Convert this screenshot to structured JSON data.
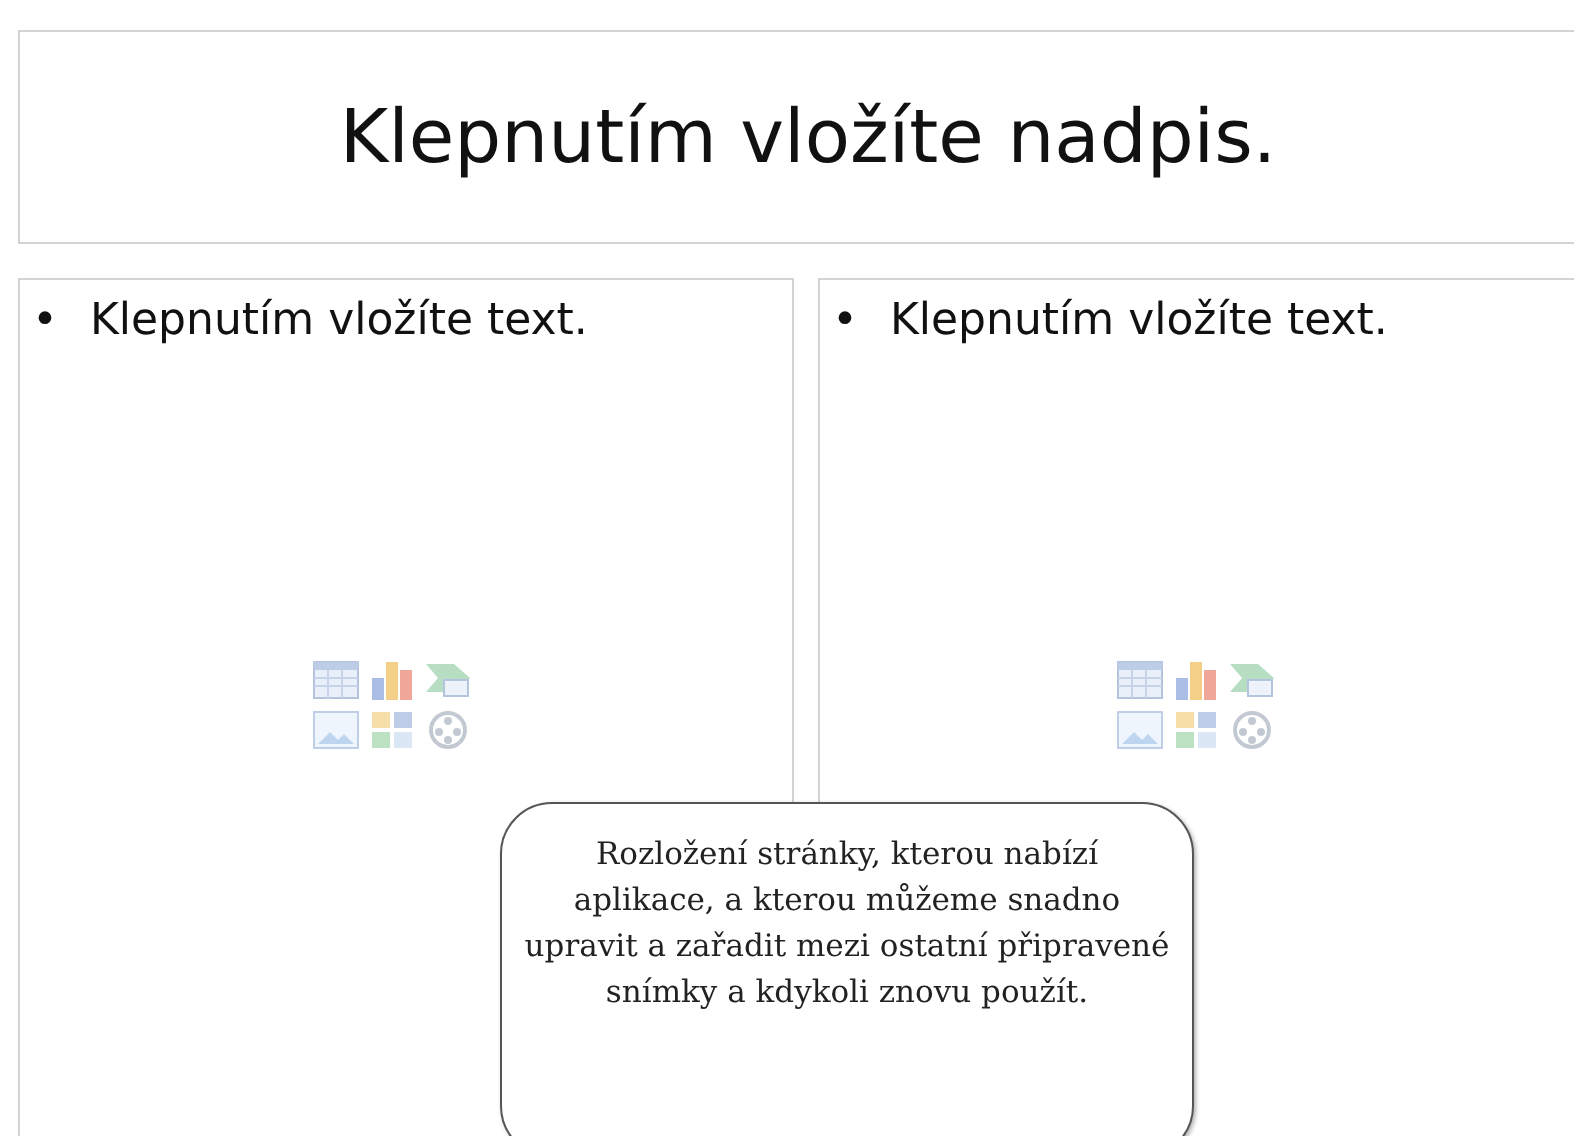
{
  "title_placeholder": {
    "text": "Klepnutím vložíte nadpis."
  },
  "content_placeholders": [
    {
      "bullet": "•",
      "text": "Klepnutím vložíte text."
    },
    {
      "bullet": "•",
      "text": "Klepnutím vložíte text."
    }
  ],
  "callout": {
    "text": "Rozložení stránky, kterou nabízí aplikace, a kterou můžeme snadno upravit a zařadit mezi ostatní připravené snímky a kdykoli znovu použít."
  }
}
